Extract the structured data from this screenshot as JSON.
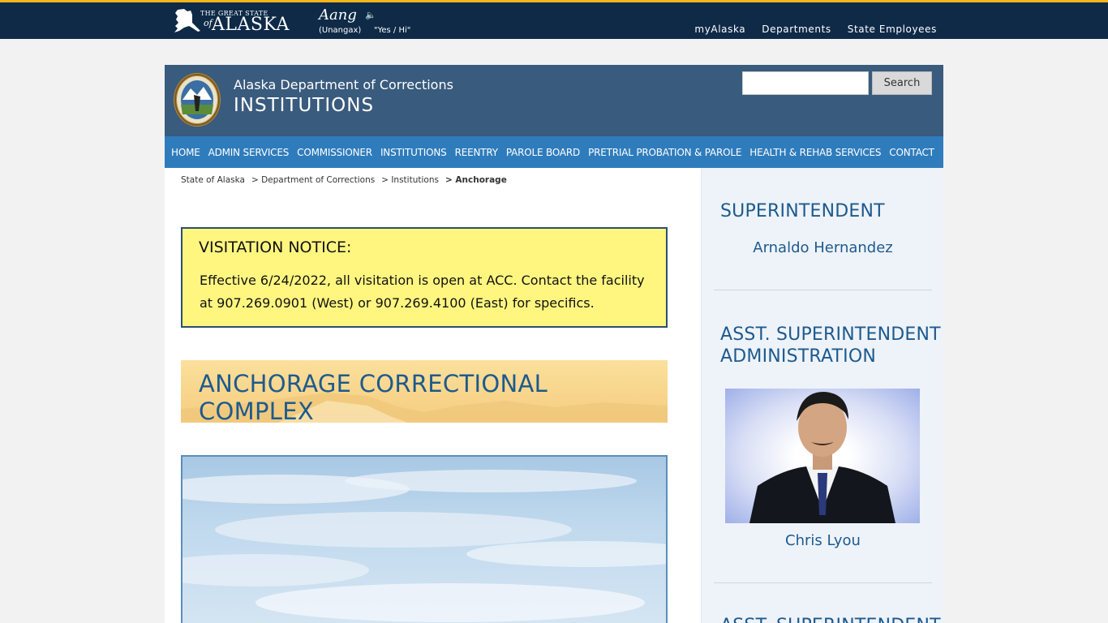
{
  "state_bar": {
    "logo_small": "THE GREAT STATE",
    "logo_of": "of",
    "logo_big": "ALASKA",
    "word": "Aang",
    "word_translation_lang": "(Unangax)",
    "word_meaning": "\"Yes / Hi\"",
    "links": [
      "myAlaska",
      "Departments",
      "State Employees"
    ]
  },
  "header": {
    "dept_name": "Alaska Department of Corrections",
    "subtitle": "INSTITUTIONS",
    "search_placeholder": "",
    "search_button": "Search"
  },
  "nav": {
    "items": [
      "HOME",
      "ADMIN SERVICES",
      "COMMISSIONER",
      "INSTITUTIONS",
      "REENTRY",
      "PAROLE BOARD",
      "PRETRIAL PROBATION & PAROLE",
      "HEALTH & REHAB SERVICES",
      "CONTACT"
    ]
  },
  "breadcrumb": {
    "items": [
      "State of Alaska",
      "> Department of Corrections",
      "> Institutions",
      "> Anchorage"
    ]
  },
  "notice": {
    "title": "VISITATION NOTICE:",
    "body": "Effective 6/24/2022, all visitation is open at ACC. Contact the facility at 907.269.0901 (West) or 907.269.4100 (East) for specifics."
  },
  "banner": {
    "title": "ANCHORAGE CORRECTIONAL COMPLEX"
  },
  "sidebar": {
    "section1_heading": "SUPERINTENDENT",
    "section1_name": "Arnaldo Hernandez",
    "section2_heading_line1": "ASST. SUPERINTENDENT",
    "section2_heading_line2": "ADMINISTRATION",
    "section2_name": "Chris Lyou",
    "section3_heading": "ASST. SUPERINTENDENT"
  },
  "colors": {
    "state_bar": "#0e2a47",
    "accent_gold": "#f2b51a",
    "header": "#395b7d",
    "nav": "#2f7cbc",
    "notice_bg": "#fff680",
    "heading_blue": "#1d5a8e"
  }
}
